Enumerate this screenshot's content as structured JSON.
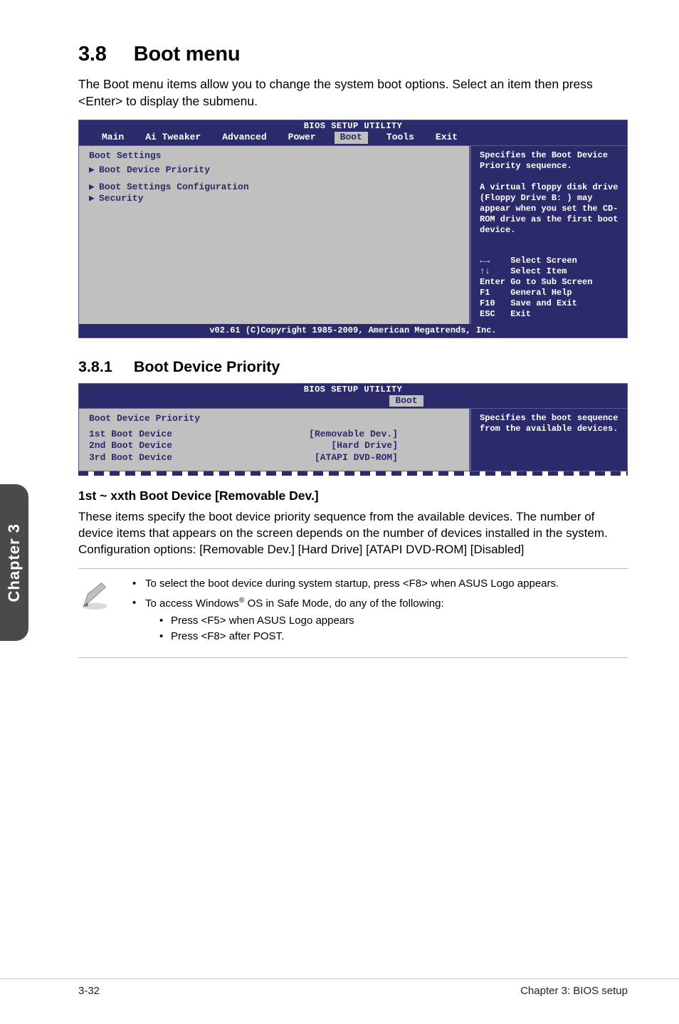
{
  "heading": {
    "number": "3.8",
    "title": "Boot menu"
  },
  "intro": "The Boot menu items allow you to change the system boot options. Select an item then press <Enter> to display the submenu.",
  "bios1": {
    "setup_title": "BIOS SETUP UTILITY",
    "menu": {
      "main": "Main",
      "ai_tweaker": "Ai Tweaker",
      "advanced": "Advanced",
      "power": "Power",
      "boot": "Boot",
      "tools": "Tools",
      "exit": "Exit"
    },
    "left": {
      "heading": "Boot Settings",
      "items": [
        "Boot Device Priority",
        "Boot Settings Configuration",
        "Security"
      ]
    },
    "right": {
      "desc": "Specifies the Boot Device Priority sequence.\n\nA virtual floppy disk drive  (Floppy Drive B: ) may appear when you set the CD-ROM drive as the first boot device.",
      "help": [
        "←→    Select Screen",
        "↑↓    Select Item",
        "Enter Go to Sub Screen",
        "F1    General Help",
        "F10   Save and Exit",
        "ESC   Exit"
      ]
    },
    "copyright": "v02.61 (C)Copyright 1985-2009, American Megatrends, Inc."
  },
  "section_381": {
    "number": "3.8.1",
    "title": "Boot Device Priority"
  },
  "bios2": {
    "setup_title": "BIOS SETUP UTILITY",
    "tab": "Boot",
    "left_heading": "Boot Device Priority",
    "rows": [
      {
        "k": "1st Boot Device",
        "v": "[Removable Dev.]"
      },
      {
        "k": "2nd Boot Device",
        "v": "[Hard Drive]"
      },
      {
        "k": "3rd Boot Device",
        "v": "[ATAPI DVD-ROM]"
      }
    ],
    "right": "Specifies the boot sequence from the available devices."
  },
  "h3": "1st ~ xxth Boot Device [Removable Dev.]",
  "body_p1": "These items specify the boot device priority sequence from the available devices. The number of device items that appears on the screen depends on the number of devices installed in the system.",
  "body_p2": "Configuration options: [Removable Dev.] [Hard Drive] [ATAPI DVD-ROM] [Disabled]",
  "note": {
    "items": [
      {
        "text": "To select the boot device during system startup, press <F8> when ASUS Logo appears."
      },
      {
        "text_prefix": "To access Windows",
        "text_sup": "®",
        "text_suffix": " OS in Safe Mode, do any of the following:",
        "sub": [
          "Press <F5> when ASUS Logo appears",
          "Press <F8> after POST."
        ]
      }
    ]
  },
  "sidebar": "Chapter 3",
  "footer": {
    "left": "3-32",
    "right": "Chapter 3: BIOS setup"
  }
}
